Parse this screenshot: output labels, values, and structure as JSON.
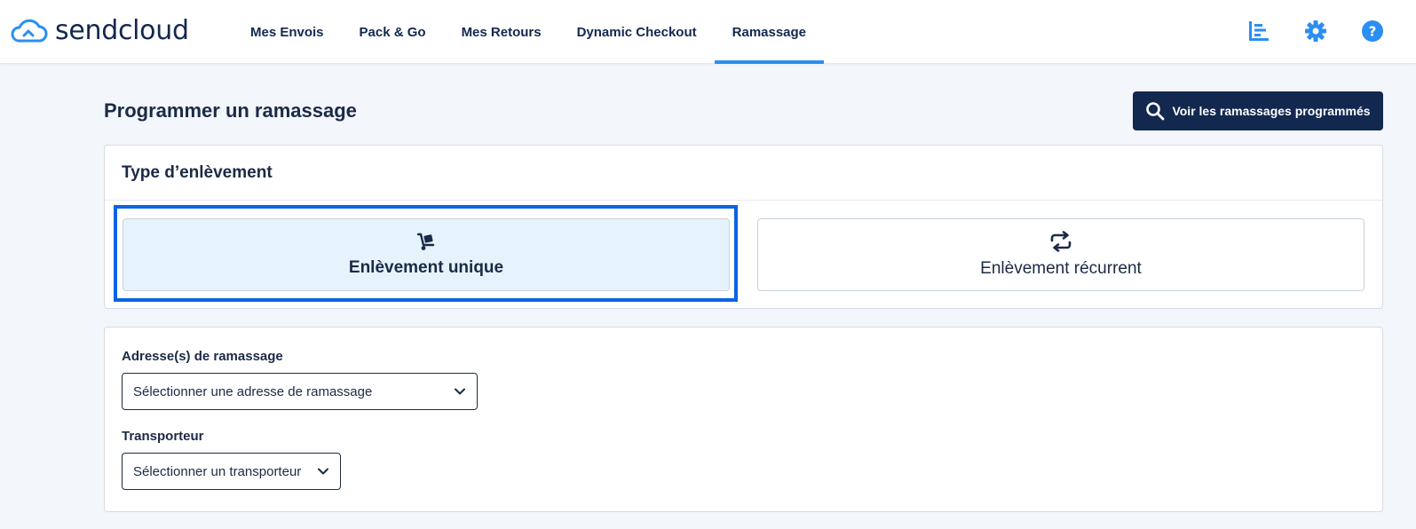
{
  "brand": {
    "name": "sendcloud",
    "accent": "#2b8ef3",
    "navy": "#12284f"
  },
  "nav": {
    "items": [
      {
        "label": "Mes Envois",
        "active": false
      },
      {
        "label": "Pack & Go",
        "active": false
      },
      {
        "label": "Mes Retours",
        "active": false
      },
      {
        "label": "Dynamic Checkout",
        "active": false
      },
      {
        "label": "Ramassage",
        "active": true
      }
    ]
  },
  "top_icons": [
    "chart-icon",
    "gear-icon",
    "help-icon"
  ],
  "page": {
    "title": "Programmer un ramassage",
    "scheduled_button_label": "Voir les ramassages programmés"
  },
  "pickup_type": {
    "title": "Type d’enlèvement",
    "options": [
      {
        "label": "Enlèvement unique",
        "icon": "hand-truck-icon",
        "selected": true
      },
      {
        "label": "Enlèvement récurrent",
        "icon": "repeat-icon",
        "selected": false
      }
    ]
  },
  "form": {
    "address": {
      "label": "Adresse(s) de ramassage",
      "value": "Sélectionner une adresse de ramassage"
    },
    "carrier": {
      "label": "Transporteur",
      "value": "Sélectionner un transporteur"
    }
  }
}
